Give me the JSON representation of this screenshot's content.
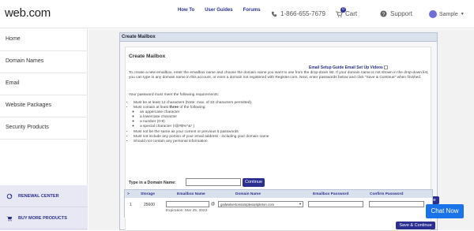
{
  "header": {
    "logo_text": "web.com",
    "nav": [
      "How To",
      "User Guides",
      "Forums"
    ],
    "phone": "1-866-655-7679",
    "cart_label": "Cart",
    "cart_count": "0",
    "support_label": "Support",
    "user_label": "Sample"
  },
  "sidebar": {
    "items": [
      "Home",
      "Domain Names",
      "Email",
      "Website Packages",
      "Security Products"
    ],
    "links": [
      "RENEWAL CENTER",
      "BUY MORE PRODUCTS"
    ]
  },
  "panel": {
    "header": "Create Mailbox",
    "title": "Create Mailbox",
    "guide_link": "Email Setup Guide Email Set Up Videos",
    "intro": "To create a new emailbox, enter the emailbox name and choose the domain name you want to use from the drop-down list. If your domain name is not shown in the drop-down list, you can type in any domain name in this account, or even a domain not registered with Register.com. Next, enter passwords below and click \"Save & Continue\" when finished.",
    "requirements_title": "Your password must meet the following requirements:",
    "req1": "Must be at least 12 characters (Note: max. of 32 characters permitted)",
    "req2_prefix": "Must contain at least ",
    "req2_bold": "three",
    "req2_suffix": " of the following:",
    "sub": [
      "an uppercase character",
      "a lowercase character",
      "a number (0-9)",
      "a special character (!@#$%^&* )"
    ],
    "req3": "Must not be the same as your current or previous 5 passwords",
    "req4": "Must not include any portion of your email address - including your domain name",
    "req5": "Should not contain any personal information",
    "domain_label": "Type in a Domain Name:",
    "continue_label": "Continue",
    "save_label": "Save & Continue"
  },
  "table": {
    "headers": [
      ">",
      "Storage",
      "Emailbox Name",
      "Domain Name",
      "Emailbox Password",
      "Confirm Password"
    ],
    "row": {
      "num": "1",
      "storage": "25600",
      "at": "@",
      "domain_selected": "gailwolvertonsamplesampleton.com",
      "expiration": "Expiration: Mar 25, 2022"
    }
  },
  "chat_label": "Chat Now"
}
